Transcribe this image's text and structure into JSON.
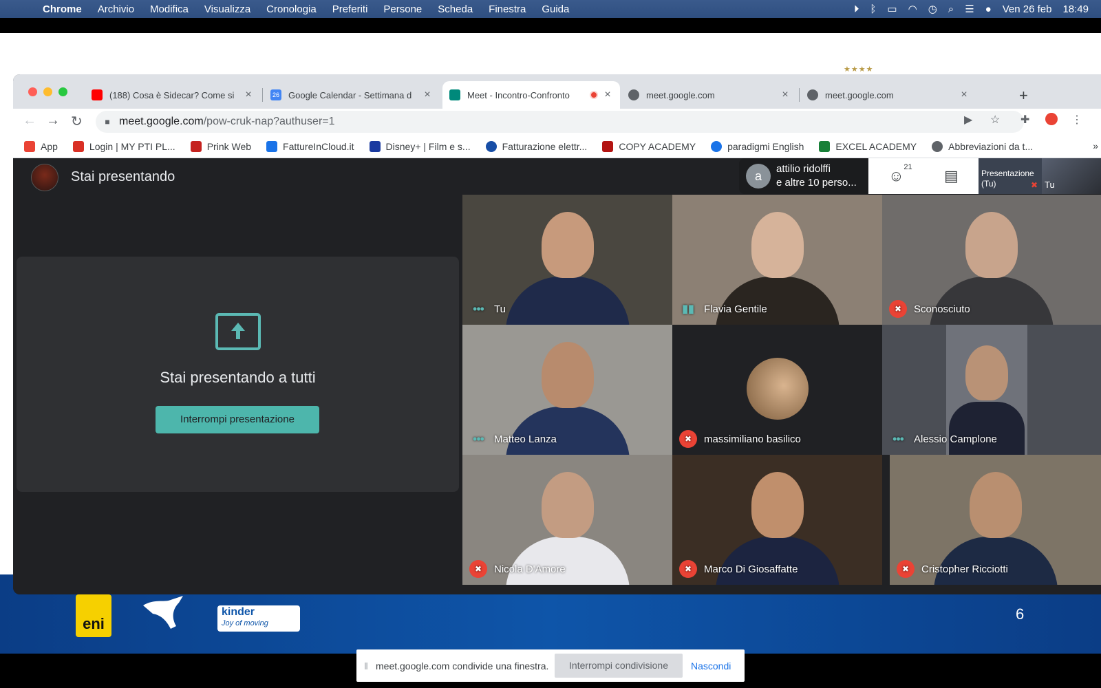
{
  "menubar": {
    "app": "Chrome",
    "items": [
      "Archivio",
      "Modifica",
      "Visualizza",
      "Cronologia",
      "Preferiti",
      "Persone",
      "Scheda",
      "Finestra",
      "Guida"
    ],
    "date": "Ven 26 feb",
    "time": "18:49"
  },
  "tabs": [
    {
      "title": "(188) Cosa è Sidecar? Come si",
      "favicon_color": "#ff0000",
      "favicon": "youtube-icon"
    },
    {
      "title": "Google Calendar - Settimana d",
      "favicon_color": "#4285f4",
      "favicon": "calendar-icon",
      "favicon_text": "26"
    },
    {
      "title": "Meet - Incontro-Confronto",
      "favicon_color": "#00897b",
      "favicon": "meet-icon"
    },
    {
      "title": "meet.google.com",
      "favicon_color": "#5f6368",
      "favicon": "globe-icon"
    },
    {
      "title": "meet.google.com",
      "favicon_color": "#5f6368",
      "favicon": "globe-icon"
    }
  ],
  "address": {
    "host": "meet.google.com",
    "path": "/pow-cruk-nap?authuser=1"
  },
  "bookmarks": [
    {
      "label": "App",
      "color": "#ea4335"
    },
    {
      "label": "Login | MY PTI PL...",
      "color": "#d93025"
    },
    {
      "label": "Prink Web",
      "color": "#c5221f"
    },
    {
      "label": "FattureInCloud.it",
      "color": "#1a73e8"
    },
    {
      "label": "Disney+ | Film e s...",
      "color": "#1a3aa0"
    },
    {
      "label": "Fatturazione elettr...",
      "color": "#174ea6"
    },
    {
      "label": "COPY ACADEMY",
      "color": "#b31412"
    },
    {
      "label": "paradigmi English",
      "color": "#1a73e8"
    },
    {
      "label": "EXCEL ACADEMY",
      "color": "#188038"
    },
    {
      "label": "Abbreviazioni da t...",
      "color": "#5f6368"
    }
  ],
  "meet": {
    "presenting_title": "Stai presentando",
    "present_heading": "Stai presentando a tutti",
    "stop_present": "Interrompi presentazione",
    "participant_name": "attilio ridolffi",
    "participant_more": "e altre 10 perso...",
    "participant_count": "21",
    "pip_presentation": "Presentazione",
    "pip_presentation_sub": "(Tu)",
    "pip_you": "Tu",
    "tiles": [
      {
        "name": "Tu",
        "indicator": "dots",
        "bg": "#4a4740",
        "skin": "#c79a7c",
        "body": "#1f2a4a"
      },
      {
        "name": "Flavia Gentile",
        "indicator": "bars",
        "bg": "#8c8074",
        "skin": "#d6b39a",
        "body": "#2a2520"
      },
      {
        "name": "Sconosciuto",
        "indicator": "muted",
        "bg": "#6f6c6a",
        "skin": "#c8a48c",
        "body": "#37373a"
      },
      {
        "name": "Matteo Lanza",
        "indicator": "dots",
        "bg": "#9a9893",
        "skin": "#b88b6d",
        "body": "#24345c"
      },
      {
        "name": "massimiliano basilico",
        "indicator": "muted",
        "bg": "#202124",
        "skin": "#d9b48f",
        "body": "#202124"
      },
      {
        "name": "Alessio Camplone",
        "indicator": "dots",
        "bg": "#4b4e55",
        "skin": "#b99276",
        "body": "#1e2233"
      },
      {
        "name": "Nicola D'Amore",
        "indicator": "muted",
        "bg": "#8a8680",
        "skin": "#c39c82",
        "body": "#e8e8ec"
      },
      {
        "name": "Marco Di Giosaffatte",
        "indicator": "muted",
        "bg": "#3b2e24",
        "skin": "#c08f6c",
        "body": "#1c2440"
      },
      {
        "name": "Cristopher Ricciotti",
        "indicator": "muted",
        "bg": "#7d7466",
        "skin": "#b98f70",
        "body": "#1d2a44"
      }
    ]
  },
  "sharebar": {
    "message": "meet.google.com condivide una finestra.",
    "stop": "Interrompi condivisione",
    "hide": "Nascondi"
  },
  "slide": {
    "page_number": "6",
    "sponsors": [
      "eni",
      "kinder",
      "Joy of moving"
    ]
  }
}
